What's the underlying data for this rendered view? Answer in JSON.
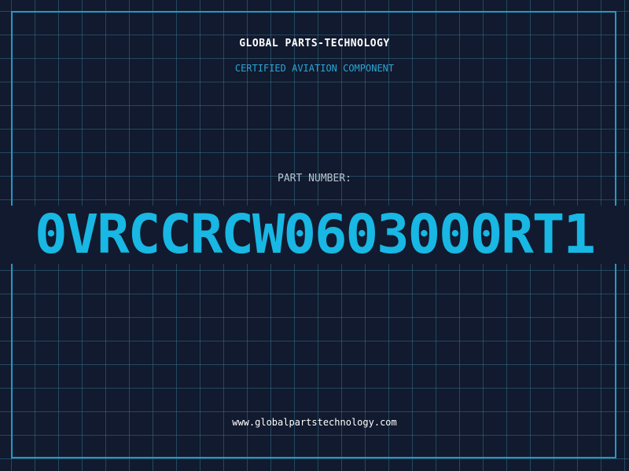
{
  "header": {
    "company": "GLOBAL PARTS-TECHNOLOGY",
    "subtitle": "CERTIFIED AVIATION COMPONENT"
  },
  "part": {
    "label": "PART NUMBER:",
    "number": "0VRCCRCW0603000RT1"
  },
  "footer": {
    "website": "www.globalpartstechnology.com"
  },
  "colors": {
    "background": "#111a2e",
    "grid": "#346e87",
    "frame": "#1f9bc7",
    "accent": "#18b7e4"
  }
}
